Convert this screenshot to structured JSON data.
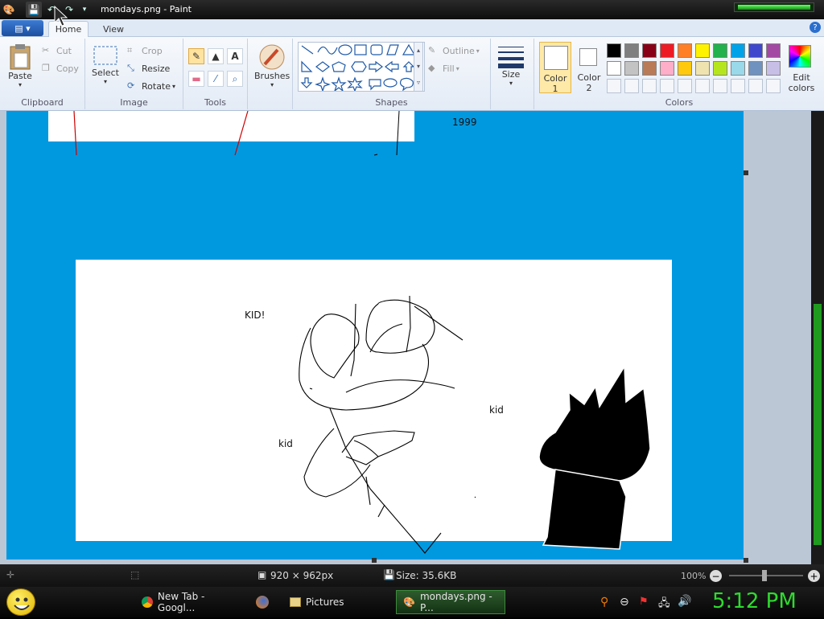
{
  "window": {
    "title": "mondays.png - Paint"
  },
  "tabs": {
    "file_icon": "menu-icon",
    "home": "Home",
    "view": "View",
    "help": "?"
  },
  "clipboard": {
    "group": "Clipboard",
    "paste": "Paste",
    "cut": "Cut",
    "copy": "Copy"
  },
  "image": {
    "group": "Image",
    "select": "Select",
    "crop": "Crop",
    "resize": "Resize",
    "rotate": "Rotate"
  },
  "tools": {
    "group": "Tools",
    "text": "A"
  },
  "brushes": {
    "label": "Brushes"
  },
  "shapes": {
    "group": "Shapes",
    "outline": "Outline",
    "fill": "Fill"
  },
  "size": {
    "label": "Size"
  },
  "colors": {
    "group": "Colors",
    "color1": "Color\n1",
    "color2": "Color\n2",
    "edit": "Edit\ncolors",
    "palette": [
      "#000000",
      "#7f7f7f",
      "#880015",
      "#ed1c24",
      "#ff7f27",
      "#fff200",
      "#22b14c",
      "#00a2e8",
      "#3f48cc",
      "#a349a4",
      "#ffffff",
      "#c3c3c3",
      "#b97a57",
      "#ffaec9",
      "#ffc90e",
      "#efe4b0",
      "#b5e61d",
      "#99d9ea",
      "#7092be",
      "#c8bfe7"
    ]
  },
  "canvas": {
    "bg_color": "#0099e0",
    "text_1999": "1999",
    "kid_exclaim": "KID!",
    "kid1": "kid",
    "kid2": "kid"
  },
  "status": {
    "dimensions": "920 × 962px",
    "size": "Size: 35.6KB",
    "zoom": "100%"
  },
  "taskbar": {
    "items": [
      {
        "label": "New Tab - Googl..."
      },
      {
        "label": ""
      },
      {
        "label": "Pictures"
      },
      {
        "label": "mondays.png - P..."
      }
    ],
    "clock": "5:12 PM"
  }
}
